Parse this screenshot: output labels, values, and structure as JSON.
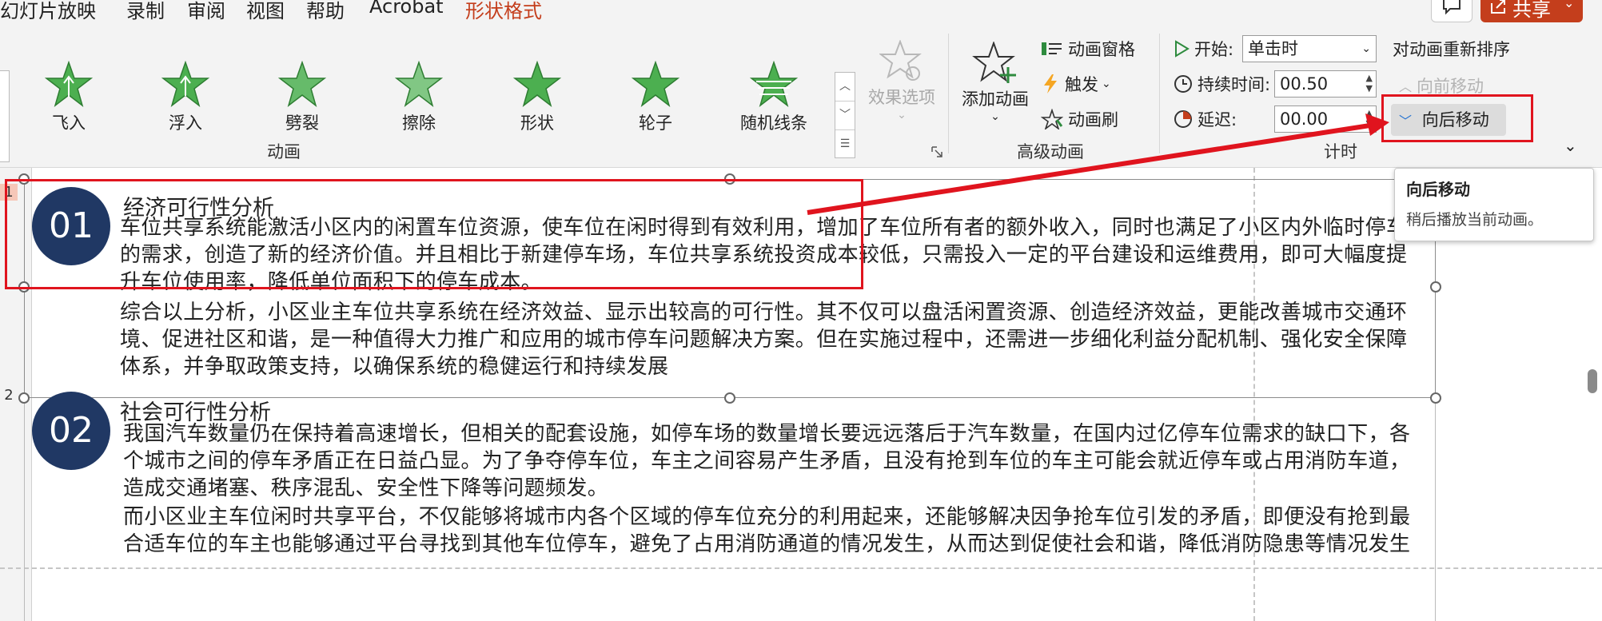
{
  "menu": {
    "items": [
      "幻灯片放映",
      "录制",
      "审阅",
      "视图",
      "帮助",
      "Acrobat",
      "形状格式"
    ],
    "active_index": 6,
    "share_label": "共享"
  },
  "ribbon": {
    "animations": {
      "group_label": "动画",
      "items": [
        "飞入",
        "浮入",
        "劈裂",
        "擦除",
        "形状",
        "轮子",
        "随机线条"
      ],
      "effect_options_label": "效果选项"
    },
    "advanced": {
      "group_label": "高级动画",
      "add_animation_label": "添加动画",
      "animation_pane_label": "动画窗格",
      "trigger_label": "触发",
      "painter_label": "动画刷"
    },
    "timing": {
      "group_label": "计时",
      "start_label": "开始:",
      "start_value": "单击时",
      "duration_label": "持续时间:",
      "duration_value": "00.50",
      "delay_label": "延迟:",
      "delay_value": "00.00",
      "reorder_label": "对动画重新排序",
      "move_earlier_label": "向前移动",
      "move_later_label": "向后移动"
    }
  },
  "tooltip": {
    "title": "向后移动",
    "description": "稍后播放当前动画。"
  },
  "slide": {
    "sections": [
      {
        "number": "01",
        "heading": "经济可行性分析",
        "paragraphs": [
          "车位共享系统能激活小区内的闲置车位资源，使车位在闲时得到有效利用，增加了车位所有者的额外收入，同时也满足了小区内外临时停车的需求，创造了新的经济价值。并且相比于新建停车场，车位共享系统投资成本较低，只需投入一定的平台建设和运维费用，即可大幅度提升车位使用率，降低单位面积下的停车成本。",
          "综合以上分析，小区业主车位共享系统在经济效益、显示出较高的可行性。其不仅可以盘活闲置资源、创造经济效益，更能改善城市交通环境、促进社区和谐，是一种值得大力推广和应用的城市停车问题解决方案。但在实施过程中，还需进一步细化利益分配机制、强化安全保障体系，并争取政策支持，以确保系统的稳健运行和持续发展"
        ]
      },
      {
        "number": "02",
        "heading": "社会可行性分析",
        "paragraphs": [
          "我国汽车数量仍在保持着高速增长，但相关的配套设施，如停车场的数量增长要远远落后于汽车数量，在国内过亿停车位需求的缺口下，各个城市之间的停车矛盾正在日益凸显。为了争夺停车位，车主之间容易产生矛盾，且没有抢到车位的车主可能会就近停车或占用消防车道，造成交通堵塞、秩序混乱、安全性下降等问题频发。",
          "而小区业主车位闲时共享平台，不仅能够将城市内各个区域的停车位充分的利用起来，还能够解决因争抢车位引发的矛盾，即便没有抢到最合适车位的车主也能够通过平台寻找到其他车位停车，避免了占用消防通道的情况发生，从而达到促使社会和谐，降低消防隐患等情况发生"
        ]
      }
    ],
    "animation_order_labels": [
      "1",
      "2"
    ]
  },
  "colors": {
    "accent": "#c43e1c",
    "circle": "#203864",
    "highlight": "#e0141e",
    "star": "#4caf50"
  }
}
